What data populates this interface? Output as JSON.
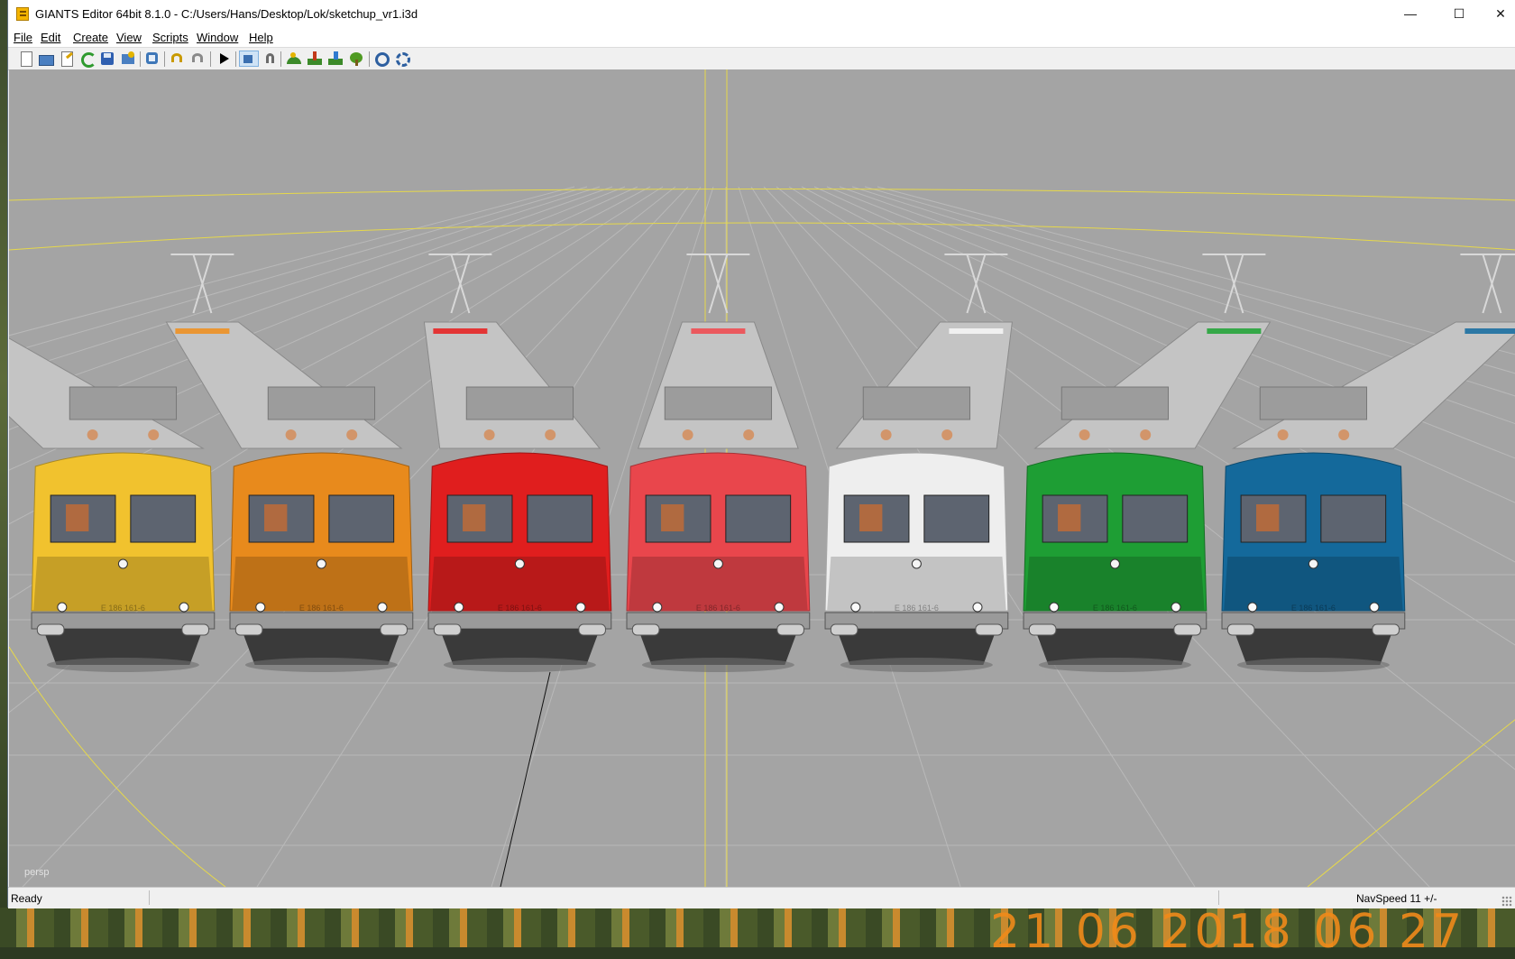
{
  "window": {
    "title": "GIANTS Editor 64bit 8.1.0 - C:/Users/Hans/Desktop/Lok/sketchup_vr1.i3d",
    "controls": {
      "minimize": "—",
      "maximize": "☐",
      "close": "✕"
    }
  },
  "menu": {
    "items": [
      {
        "label": "File"
      },
      {
        "label": "Edit"
      },
      {
        "label": "Create"
      },
      {
        "label": "View"
      },
      {
        "label": "Scripts"
      },
      {
        "label": "Window"
      },
      {
        "label": "Help"
      }
    ]
  },
  "toolbar": {
    "icons": [
      "new-file-icon",
      "open-file-icon",
      "edit-file-icon",
      "refresh-icon",
      "save-icon",
      "export-icon",
      "import-icon",
      "undo-icon",
      "redo-icon",
      "play-icon",
      "select-icon",
      "magnet-icon",
      "terrain-icon",
      "paint-icon",
      "sculpt-icon",
      "foliage-icon",
      "settings-icon",
      "preferences-icon"
    ]
  },
  "viewport": {
    "camera_label": "persp",
    "background": "#a4a4a4",
    "grid_color": "#b9b9b9",
    "axis_color": "#e6d84a",
    "locomotive_number": "E 186 161-6",
    "locomotives": [
      {
        "name": "yellow",
        "color": "#f1c22e"
      },
      {
        "name": "orange",
        "color": "#e88a1c"
      },
      {
        "name": "red",
        "color": "#e01e1e"
      },
      {
        "name": "light-red",
        "color": "#e9464c"
      },
      {
        "name": "white",
        "color": "#eeeeee"
      },
      {
        "name": "green",
        "color": "#1e9e34"
      },
      {
        "name": "blue",
        "color": "#14699b"
      }
    ]
  },
  "status": {
    "text": "Ready",
    "navspeed": "NavSpeed 11 +/-"
  },
  "desktop": {
    "photo_stamp": "21 06 2018 06 27"
  }
}
